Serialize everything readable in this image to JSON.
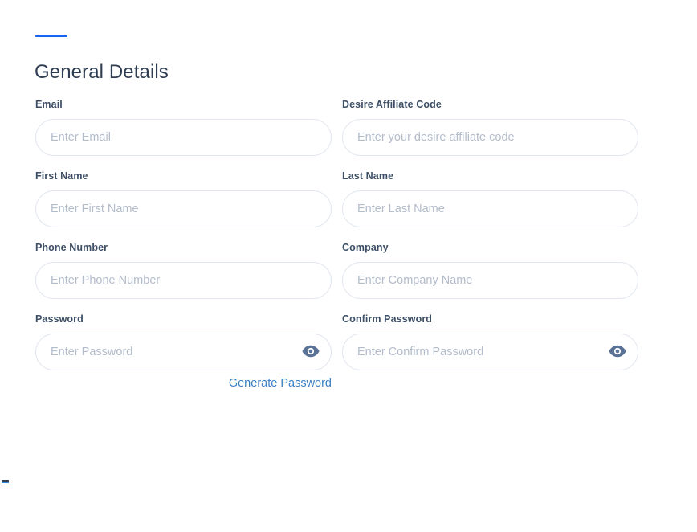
{
  "theme": {
    "accent_blue": "#1565f0",
    "link_blue": "#3a7fc4",
    "label_color": "#3d4f66",
    "heading_color": "#2e3d52",
    "placeholder_color": "#b3bccb",
    "input_border": "#e2e7ef",
    "eye_icon_color": "#5a7296",
    "page_background": "#ffffff"
  },
  "header": {
    "title": "General Details"
  },
  "form": {
    "rows": [
      {
        "left": {
          "label": "Email",
          "placeholder": "Enter Email",
          "value": ""
        },
        "right": {
          "label": "Desire Affiliate Code",
          "placeholder": "Enter your desire affiliate code",
          "value": ""
        }
      },
      {
        "left": {
          "label": "First Name",
          "placeholder": "Enter First Name",
          "value": ""
        },
        "right": {
          "label": "Last Name",
          "placeholder": "Enter Last Name",
          "value": ""
        }
      },
      {
        "left": {
          "label": "Phone Number",
          "placeholder": "Enter Phone Number",
          "value": ""
        },
        "right": {
          "label": "Company",
          "placeholder": "Enter Company Name",
          "value": ""
        }
      },
      {
        "left": {
          "label": "Password",
          "placeholder": "Enter Password",
          "value": "",
          "icon": "eye-icon",
          "helper_link": "Generate Password"
        },
        "right": {
          "label": "Confirm Password",
          "placeholder": "Enter Confirm Password",
          "value": "",
          "icon": "eye-icon"
        }
      }
    ]
  }
}
